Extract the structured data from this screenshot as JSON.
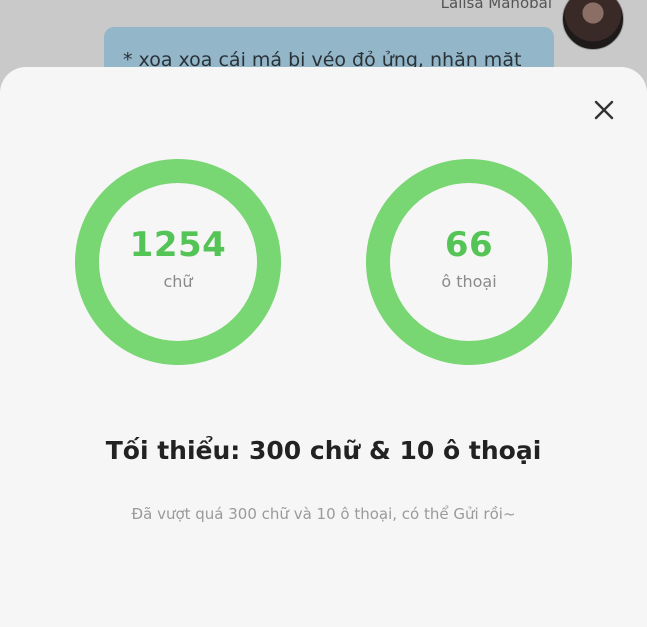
{
  "background": {
    "sender_name": "Lalisa Manobal",
    "message_text": "* xoa xoa cái má bị véo đỏ ửng, nhăn mặt"
  },
  "stats": [
    {
      "value": "1254",
      "unit": "chữ"
    },
    {
      "value": "66",
      "unit": "ô thoại"
    }
  ],
  "requirement": "Tối thiểu: 300 chữ & 10 ô thoại",
  "status_message": "Đã vượt quá 300 chữ và 10 ô thoại, có thể Gửi rồi~",
  "colors": {
    "ring": "#78d673",
    "number": "#55c457"
  },
  "icons": {
    "close": "close-icon"
  }
}
